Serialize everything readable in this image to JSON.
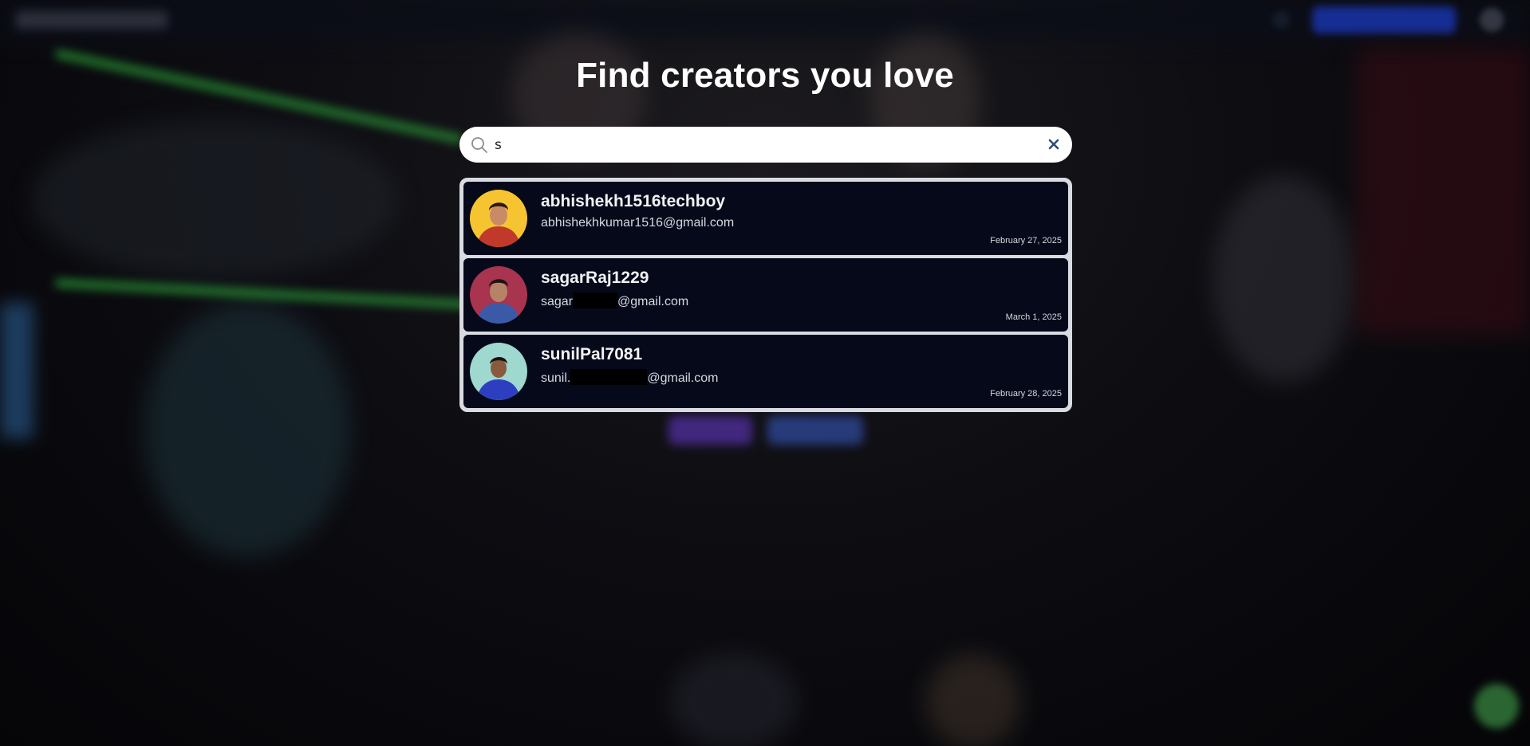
{
  "page": {
    "heading": "Find creators you love"
  },
  "search": {
    "value": "s",
    "placeholder": ""
  },
  "results": [
    {
      "username": "abhishekh1516techboy",
      "email_prefix": "abhishekhkumar1516@gmail.com",
      "email_suffix": "",
      "date": "February 27, 2025",
      "avatar_bg": "#f5c430",
      "avatar_shirt": "#c0392b"
    },
    {
      "username": "sagarRaj1229",
      "email_prefix": "sagar",
      "email_suffix": "@gmail.com",
      "date": "March 1, 2025",
      "avatar_bg": "#a8344f",
      "avatar_shirt": "#3a5aa8"
    },
    {
      "username": "sunilPal7081",
      "email_prefix": "sunil.",
      "email_suffix": "@gmail.com",
      "date": "February 28, 2025",
      "avatar_bg": "#9fd8cf",
      "avatar_shirt": "#2d3fc0"
    }
  ],
  "colors": {
    "card_bg": "#05091a",
    "card_border": "#d9dbe2",
    "heading": "#ffffff",
    "clear_icon": "#2f4a7a"
  }
}
